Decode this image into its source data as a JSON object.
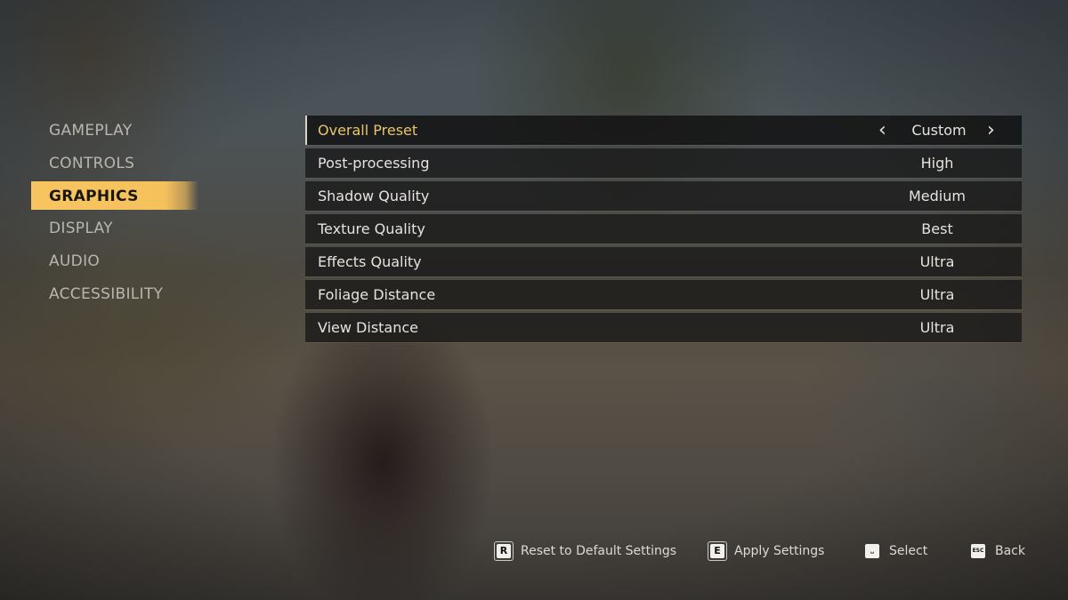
{
  "nav": {
    "items": [
      {
        "label": "GAMEPLAY",
        "active": false
      },
      {
        "label": "CONTROLS",
        "active": false
      },
      {
        "label": "GRAPHICS",
        "active": true
      },
      {
        "label": "DISPLAY",
        "active": false
      },
      {
        "label": "AUDIO",
        "active": false
      },
      {
        "label": "ACCESSIBILITY",
        "active": false
      }
    ]
  },
  "settings": {
    "rows": [
      {
        "label": "Overall Preset",
        "value": "Custom",
        "focused": true
      },
      {
        "label": "Post-processing",
        "value": "High"
      },
      {
        "label": "Shadow Quality",
        "value": "Medium"
      },
      {
        "label": "Texture Quality",
        "value": "Best"
      },
      {
        "label": "Effects Quality",
        "value": "Ultra"
      },
      {
        "label": "Foliage Distance",
        "value": "Ultra"
      },
      {
        "label": "View Distance",
        "value": "Ultra"
      }
    ],
    "prev_icon": "‹",
    "next_icon": "›"
  },
  "footer": {
    "hints": [
      {
        "key": "R",
        "label": "Reset to Default Settings"
      },
      {
        "key": "E",
        "label": "Apply Settings"
      },
      {
        "key": "␣",
        "label": "Select"
      },
      {
        "key": "ESC",
        "label": "Back"
      }
    ]
  },
  "colors": {
    "accent": "#f6c15c",
    "focused_label": "#e9c46b",
    "text": "#e6e3de"
  }
}
